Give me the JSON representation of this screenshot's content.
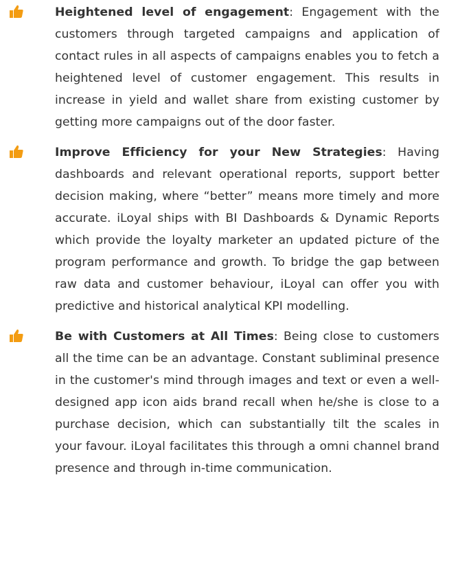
{
  "colors": {
    "icon": "#f39c12",
    "text": "#333333",
    "background": "#ffffff"
  },
  "items": [
    {
      "icon": "thumbs-up-icon",
      "title": "Heightened level of engagement",
      "body": ": Engagement with the customers through targeted campaigns and application of contact rules in all aspects of campaigns enables you to fetch a heightened level of customer engagement. This results in increase in yield and wallet share from existing customer by getting more campaigns out of the door faster."
    },
    {
      "icon": "thumbs-up-icon",
      "title": "Improve Efficiency for your New Strategies",
      "body": ": Having dashboards and relevant operational reports, support better decision making, where “better” means more timely and more accurate. iLoyal ships with BI Dashboards & Dynamic Reports which provide the loyalty marketer an updated picture of the program performance and growth. To bridge the gap between raw data and customer behaviour, iLoyal can offer you with predictive and historical analytical KPI modelling."
    },
    {
      "icon": "thumbs-up-icon",
      "title": "Be with Customers at All Times",
      "body": ": Being close to customers all the time can be an advantage. Constant subliminal presence in the customer's mind through images and text or even a well-designed app icon aids brand recall when he/she is close to a purchase decision, which can substantially tilt the scales in your favour. iLoyal facilitates this through a omni channel brand presence and through in-time communication."
    }
  ]
}
